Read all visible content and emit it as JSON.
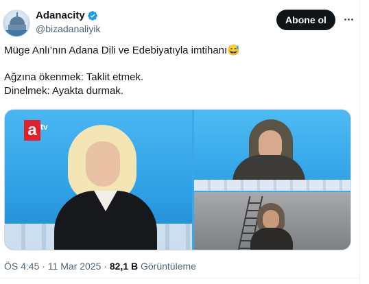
{
  "author": {
    "display_name": "Adanacity",
    "handle": "@bizadanaliyik",
    "verified": true,
    "avatar_icon": "city-logo-avatar"
  },
  "actions": {
    "follow_label": "Abone ol",
    "more_icon": "more-horizontal-icon"
  },
  "tweet": {
    "lines": [
      "Müge Anlı’nın Adana Dili ve Edebiyatıyla imtihanı😅",
      "",
      "Ağzına ökenmek: Taklit etmek.",
      "Dinelmek: Ayakta durmak."
    ]
  },
  "media": {
    "channel_logo": "a",
    "channel_logo_suffix": "tv"
  },
  "meta": {
    "time": "ÖS 4:45",
    "separator": " · ",
    "date": "11 Mar 2025",
    "views_count": "82,1 B",
    "views_label": " Görüntüleme"
  },
  "colors": {
    "follow_bg": "#0f1419",
    "verified_blue": "#1d9bf0",
    "secondary_text": "#536471"
  }
}
